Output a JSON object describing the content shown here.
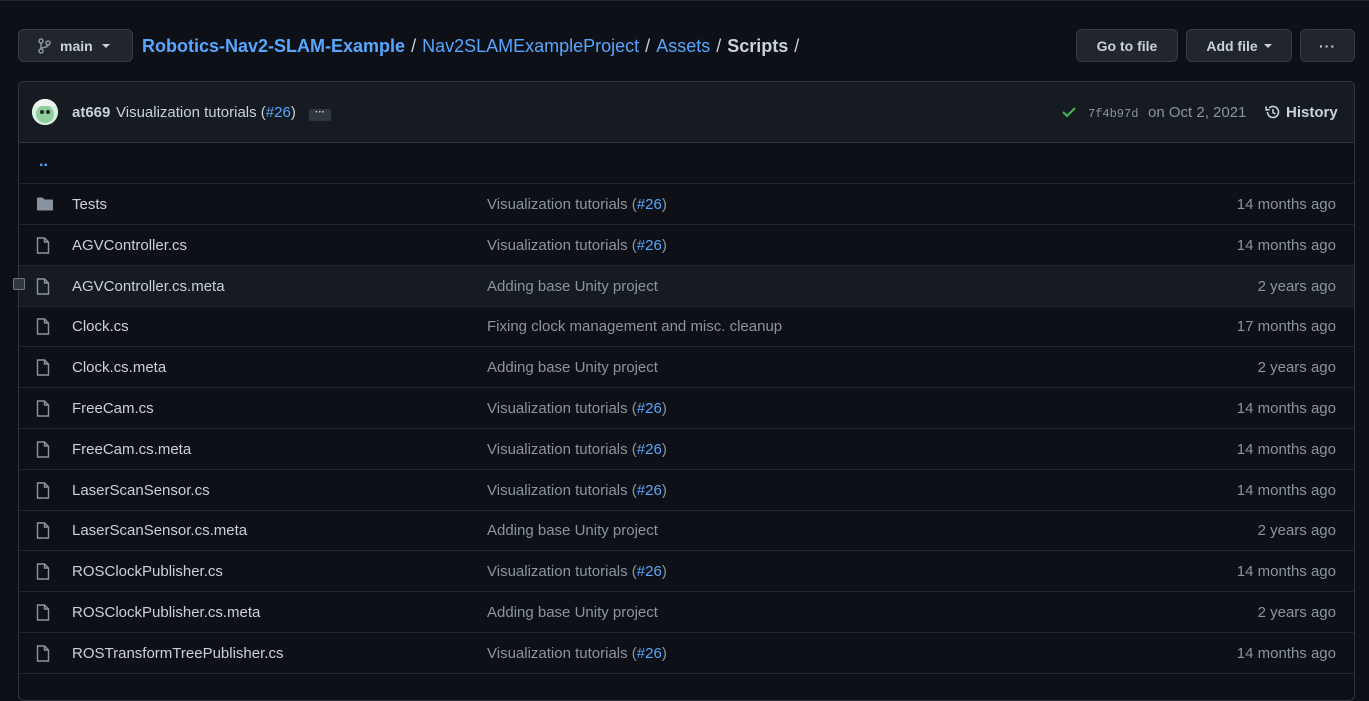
{
  "branch": {
    "name": "main",
    "icon": "git-branch-icon"
  },
  "breadcrumb": [
    {
      "label": "Robotics-Nav2-SLAM-Example",
      "type": "repo"
    },
    {
      "label": "Nav2SLAMExampleProject",
      "type": "link"
    },
    {
      "label": "Assets",
      "type": "link"
    },
    {
      "label": "Scripts",
      "type": "current"
    }
  ],
  "breadcrumb_sep": "/",
  "toolbar": {
    "go_to_file": "Go to file",
    "add_file": "Add file",
    "more": "···"
  },
  "commit": {
    "author": "at669",
    "message_prefix": "Visualization tutorials (",
    "pr": "#26",
    "message_suffix": ")",
    "ellipsis": "···",
    "sha": "7f4b97d",
    "date": "on Oct 2, 2021",
    "history_label": "History",
    "status": "success"
  },
  "parent_dir": "..",
  "files": [
    {
      "name": "Tests",
      "kind": "folder",
      "msg_prefix": "Visualization tutorials (",
      "pr": "#26",
      "msg_suffix": ")",
      "age": "14 months ago"
    },
    {
      "name": "AGVController.cs",
      "kind": "file",
      "msg_prefix": "Visualization tutorials (",
      "pr": "#26",
      "msg_suffix": ")",
      "age": "14 months ago"
    },
    {
      "name": "AGVController.cs.meta",
      "kind": "file",
      "msg_prefix": "Adding base Unity project",
      "pr": "",
      "msg_suffix": "",
      "age": "2 years ago"
    },
    {
      "name": "Clock.cs",
      "kind": "file",
      "msg_prefix": "Fixing clock management and misc. cleanup",
      "pr": "",
      "msg_suffix": "",
      "age": "17 months ago"
    },
    {
      "name": "Clock.cs.meta",
      "kind": "file",
      "msg_prefix": "Adding base Unity project",
      "pr": "",
      "msg_suffix": "",
      "age": "2 years ago"
    },
    {
      "name": "FreeCam.cs",
      "kind": "file",
      "msg_prefix": "Visualization tutorials (",
      "pr": "#26",
      "msg_suffix": ")",
      "age": "14 months ago"
    },
    {
      "name": "FreeCam.cs.meta",
      "kind": "file",
      "msg_prefix": "Visualization tutorials (",
      "pr": "#26",
      "msg_suffix": ")",
      "age": "14 months ago"
    },
    {
      "name": "LaserScanSensor.cs",
      "kind": "file",
      "msg_prefix": "Visualization tutorials (",
      "pr": "#26",
      "msg_suffix": ")",
      "age": "14 months ago"
    },
    {
      "name": "LaserScanSensor.cs.meta",
      "kind": "file",
      "msg_prefix": "Adding base Unity project",
      "pr": "",
      "msg_suffix": "",
      "age": "2 years ago"
    },
    {
      "name": "ROSClockPublisher.cs",
      "kind": "file",
      "msg_prefix": "Visualization tutorials (",
      "pr": "#26",
      "msg_suffix": ")",
      "age": "14 months ago"
    },
    {
      "name": "ROSClockPublisher.cs.meta",
      "kind": "file",
      "msg_prefix": "Adding base Unity project",
      "pr": "",
      "msg_suffix": "",
      "age": "2 years ago"
    },
    {
      "name": "ROSTransformTreePublisher.cs",
      "kind": "file",
      "msg_prefix": "Visualization tutorials (",
      "pr": "#26",
      "msg_suffix": ")",
      "age": "14 months ago"
    }
  ],
  "colors": {
    "background": "#0d1117",
    "link": "#58a6ff",
    "muted": "#8b949e",
    "text": "#c9d1d9",
    "success": "#3fb950"
  }
}
